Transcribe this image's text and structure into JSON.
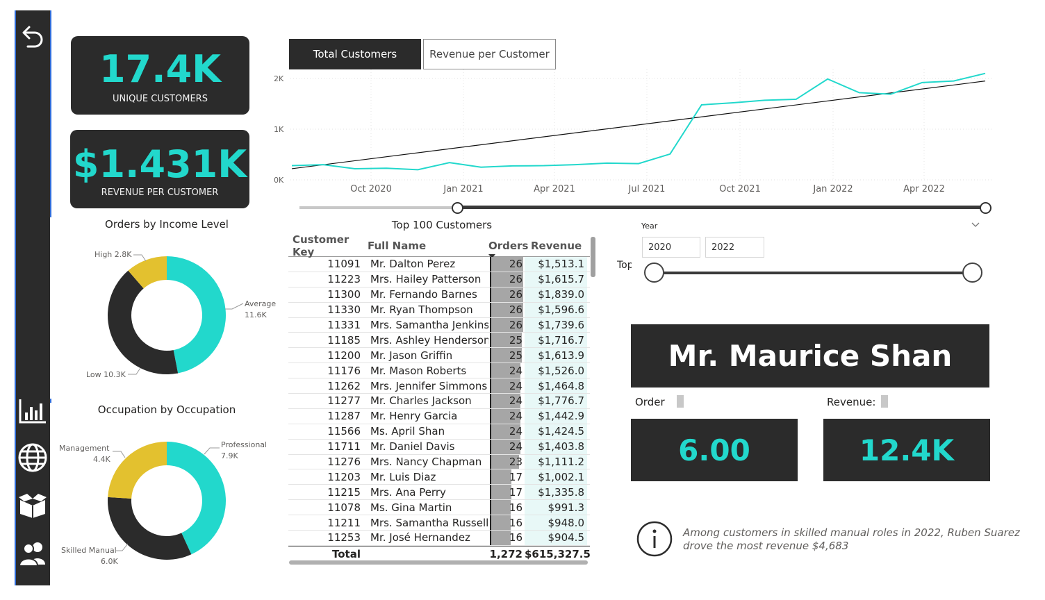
{
  "sidebar": {
    "items": [
      {
        "icon": "back-arrow-icon"
      },
      {
        "icon": "bar-chart-icon"
      },
      {
        "icon": "globe-icon"
      },
      {
        "icon": "box-icon"
      },
      {
        "icon": "people-icon"
      }
    ]
  },
  "kpis": {
    "unique_customers": {
      "value": "17.4K",
      "label": "UNIQUE CUSTOMERS"
    },
    "revenue_per_customer": {
      "value": "$1.431K",
      "label": "REVENUE PER CUSTOMER"
    }
  },
  "income_chart": {
    "title": "Orders by Income Level",
    "labels": {
      "high": "High 2.8K",
      "average_name": "Average",
      "average_val": "11.6K",
      "low": "Low 10.3K"
    }
  },
  "occupation_chart": {
    "title": "Occupation by Occupation",
    "labels": {
      "management_name": "Management",
      "management_val": "4.4K",
      "professional_name": "Professional",
      "professional_val": "7.9K",
      "skilled_name": "Skilled Manual",
      "skilled_val": "6.0K"
    }
  },
  "tabs": {
    "total_customers": "Total Customers",
    "revenue_per_customer": "Revenue per Customer"
  },
  "line_chart_axis": {
    "y_ticks": [
      "2K",
      "1K",
      "0K"
    ],
    "x_ticks": [
      "Oct 2020",
      "Jan 2021",
      "Apr 2021",
      "Jul 2021",
      "Oct 2021",
      "Jan 2022",
      "Apr 2022"
    ]
  },
  "table": {
    "title": "Top 100 Customers",
    "headers": {
      "key": "Customer Key",
      "name": "Full Name",
      "orders": "Orders",
      "revenue": "Revenue"
    },
    "rows": [
      {
        "key": "11091",
        "name": "Mr. Dalton Perez",
        "orders": "26",
        "revenue": "$1,513.1"
      },
      {
        "key": "11223",
        "name": "Mrs. Hailey Patterson",
        "orders": "26",
        "revenue": "$1,615.7"
      },
      {
        "key": "11300",
        "name": "Mr. Fernando Barnes",
        "orders": "26",
        "revenue": "$1,839.0"
      },
      {
        "key": "11330",
        "name": "Mr. Ryan Thompson",
        "orders": "26",
        "revenue": "$1,596.6"
      },
      {
        "key": "11331",
        "name": "Mrs. Samantha Jenkins",
        "orders": "26",
        "revenue": "$1,739.6"
      },
      {
        "key": "11185",
        "name": "Mrs. Ashley Henderson",
        "orders": "25",
        "revenue": "$1,716.7"
      },
      {
        "key": "11200",
        "name": "Mr. Jason Griffin",
        "orders": "25",
        "revenue": "$1,613.9"
      },
      {
        "key": "11176",
        "name": "Mr. Mason Roberts",
        "orders": "24",
        "revenue": "$1,526.0"
      },
      {
        "key": "11262",
        "name": "Mrs. Jennifer Simmons",
        "orders": "24",
        "revenue": "$1,464.8"
      },
      {
        "key": "11277",
        "name": "Mr. Charles Jackson",
        "orders": "24",
        "revenue": "$1,776.7"
      },
      {
        "key": "11287",
        "name": "Mr. Henry Garcia",
        "orders": "24",
        "revenue": "$1,442.9"
      },
      {
        "key": "11566",
        "name": "Ms. April Shan",
        "orders": "24",
        "revenue": "$1,424.5"
      },
      {
        "key": "11711",
        "name": "Mr. Daniel Davis",
        "orders": "24",
        "revenue": "$1,403.8"
      },
      {
        "key": "11276",
        "name": "Mrs. Nancy Chapman",
        "orders": "23",
        "revenue": "$1,111.2"
      },
      {
        "key": "11203",
        "name": "Mr. Luis Diaz",
        "orders": "17",
        "revenue": "$1,002.1"
      },
      {
        "key": "11215",
        "name": "Mrs. Ana Perry",
        "orders": "17",
        "revenue": "$1,335.8"
      },
      {
        "key": "11078",
        "name": "Ms. Gina Martin",
        "orders": "16",
        "revenue": "$991.3"
      },
      {
        "key": "11211",
        "name": "Mrs. Samantha Russell",
        "orders": "16",
        "revenue": "$948.0"
      },
      {
        "key": "11253",
        "name": "Mr. José Hernandez",
        "orders": "16",
        "revenue": "$904.5"
      }
    ],
    "total": {
      "label": "Total",
      "orders": "1,272",
      "revenue": "$615,327.5"
    }
  },
  "year_filter": {
    "label": "Year",
    "from": "2020",
    "to": "2022"
  },
  "top_label": "Top",
  "customer_card": {
    "name": "Mr. Maurice Shan"
  },
  "order_label": "Order",
  "revenue_label": "Revenue:",
  "order_value": "6.00",
  "revenue_value": "12.4K",
  "insight": {
    "line1": "Among customers in skilled manual roles in 2022, Ruben Suarez",
    "line2": "drove the most revenue $4,683"
  },
  "colors": {
    "accent": "#22d8cc",
    "dark": "#2b2b2b",
    "yellow": "#e3c12f",
    "sidebar_border": "#2f6bd6"
  },
  "chart_data": [
    {
      "type": "pie",
      "title": "Orders by Income Level",
      "categories": [
        "Average",
        "Low",
        "High"
      ],
      "values": [
        11.6,
        10.3,
        2.8
      ],
      "unit": "K"
    },
    {
      "type": "pie",
      "title": "Occupation by Occupation",
      "categories": [
        "Professional",
        "Skilled Manual",
        "Management"
      ],
      "values": [
        7.9,
        6.0,
        4.4
      ],
      "unit": "K"
    },
    {
      "type": "line",
      "x": [
        "Aug 2020",
        "Sep 2020",
        "Oct 2020",
        "Nov 2020",
        "Dec 2020",
        "Jan 2021",
        "Feb 2021",
        "Mar 2021",
        "Apr 2021",
        "May 2021",
        "Jun 2021",
        "Jul 2021",
        "Aug 2021",
        "Sep 2021",
        "Oct 2021",
        "Nov 2021",
        "Dec 2021",
        "Jan 2022",
        "Feb 2022",
        "Mar 2022",
        "Apr 2022",
        "May 2022",
        "Jun 2022"
      ],
      "series": [
        {
          "values": [
            280,
            300,
            220,
            230,
            200,
            340,
            250,
            275,
            280,
            300,
            330,
            320,
            510,
            1480,
            1520,
            1570,
            1590,
            1990,
            1720,
            1690,
            1920,
            1950,
            2100
          ]
        }
      ],
      "trendline": {
        "start": 220,
        "end": 1950
      },
      "ylim": [
        0,
        2200
      ],
      "y_ticks": [
        "0K",
        "1K",
        "2K"
      ],
      "x_ticks": [
        "Oct 2020",
        "Jan 2021",
        "Apr 2021",
        "Jul 2021",
        "Oct 2021",
        "Jan 2022",
        "Apr 2022"
      ],
      "grid": true
    }
  ]
}
